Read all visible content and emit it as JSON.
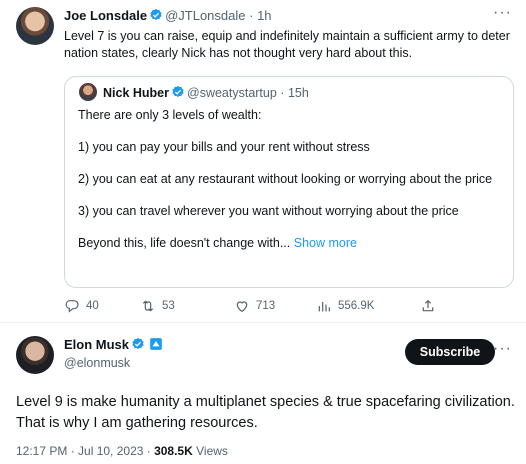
{
  "tweet1": {
    "author_name": "Joe Lonsdale",
    "author_handle": "@JTLonsdale",
    "separator": "·",
    "time": "1h",
    "text": "Level 7 is you can raise, equip and indefinitely maintain a sufficient army to deter nation states, clearly Nick has not thought very hard about this.",
    "quote": {
      "author_name": "Nick Huber",
      "author_handle": "@sweatystartup",
      "time": "15h",
      "line1": "There are only 3 levels of wealth:",
      "line2": "1) you can pay your bills and your rent without stress",
      "line3": "2) you can eat at any restaurant without looking or worrying about the price",
      "line4": "3) you can travel wherever you want without worrying about the price",
      "line5": "Beyond this, life doesn't change with...",
      "show_more": "Show more"
    },
    "actions": {
      "replies": "40",
      "reposts": "53",
      "likes": "713",
      "views": "556.9K"
    }
  },
  "tweet2": {
    "author_name": "Elon Musk",
    "author_handle": "@elonmusk",
    "subscribe_label": "Subscribe",
    "text": "Level 9 is make humanity a multiplanet species & true spacefaring civilization. That is why I am gathering resources.",
    "timestamp": "12:17 PM · Jul 10, 2023 · ",
    "views_count": "308.5K",
    "views_label": " Views"
  },
  "colors": {
    "verified_blue": "#1d9bf0",
    "text_secondary": "#536471",
    "link": "#1d9bf0"
  },
  "icons": [
    "more-icon",
    "verified-icon",
    "reply-icon",
    "repost-icon",
    "like-icon",
    "views-icon",
    "share-icon",
    "subscription-badge-icon"
  ]
}
